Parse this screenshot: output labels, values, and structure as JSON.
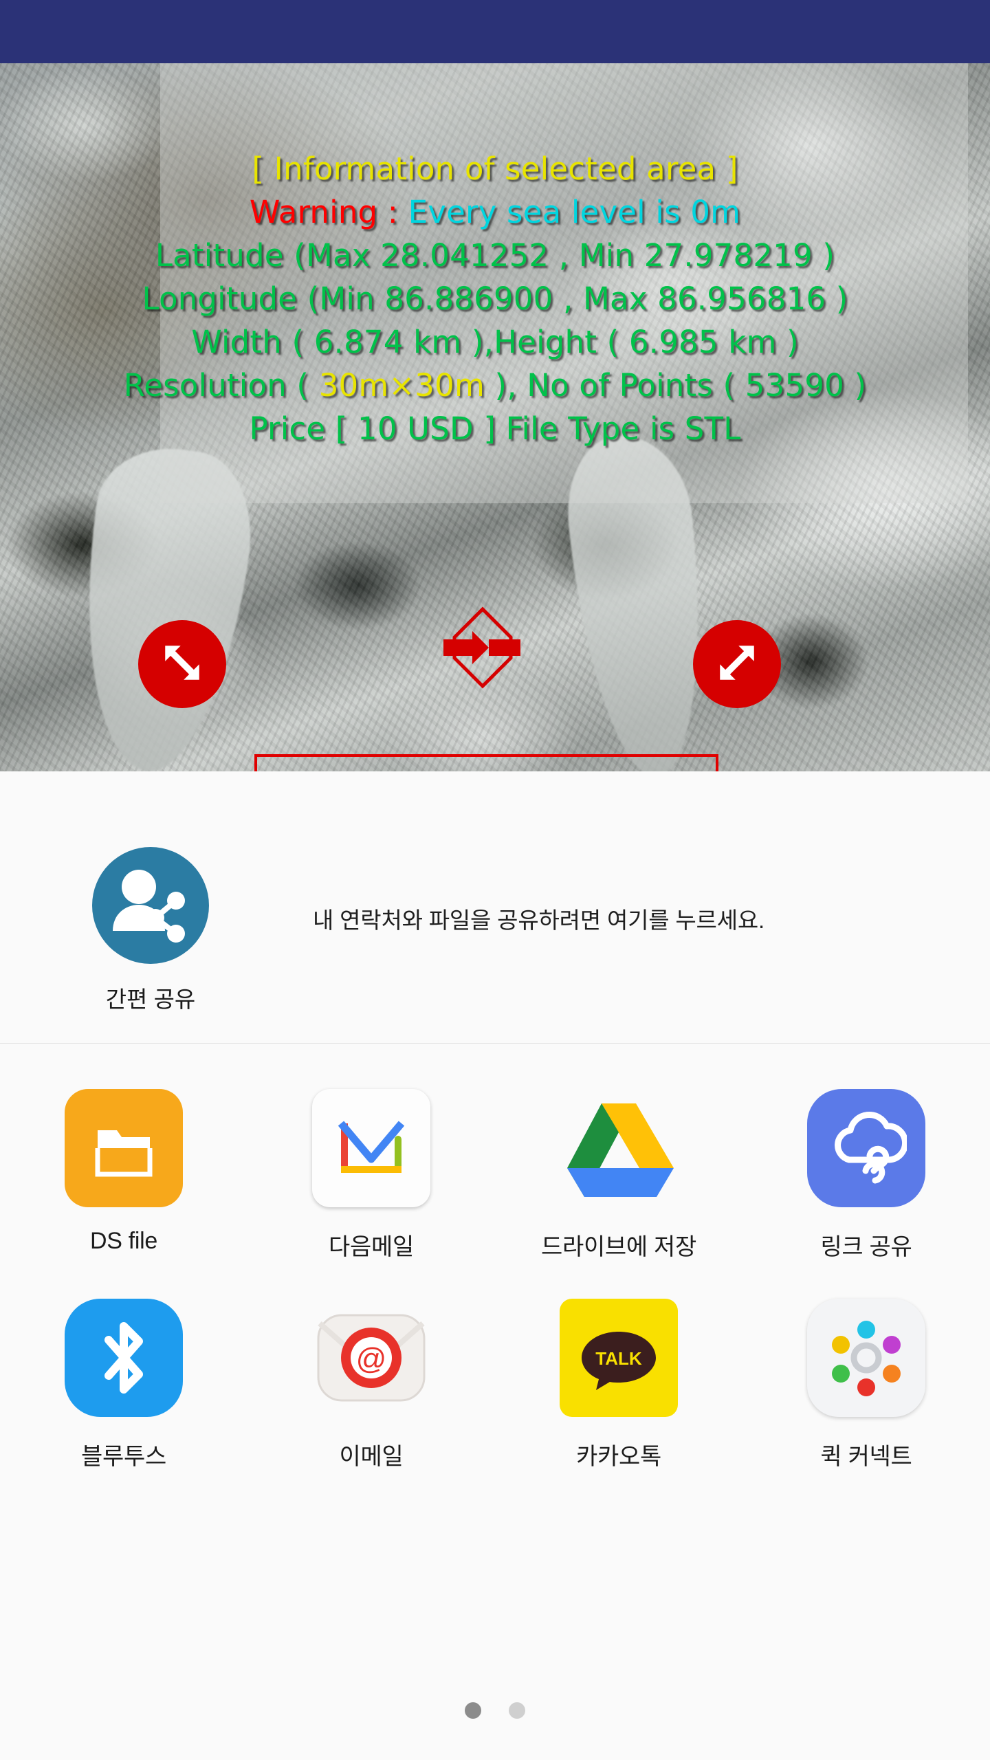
{
  "statusbar": {
    "color": "#2b3277"
  },
  "map_overlay": {
    "title": "[ Information of selected area ]",
    "warning_label": "Warning :",
    "warning_text": " Every sea level is 0m",
    "latitude": "Latitude (Max 28.041252 , Min 27.978219 )",
    "longitude": "Longitude (Min 86.886900 , Max 86.956816 )",
    "size": "Width ( 6.874 km ),Height ( 6.985 km )",
    "resolution_prefix": "Resolution ( ",
    "resolution_value": "30m×30m",
    "resolution_suffix": " ), No of Points ( 53590 )",
    "price": "Price [ 10 USD ] File Type is STL",
    "colors": {
      "title": "#e8e400",
      "warning": "#ff0000",
      "warning_text": "#00d6e0",
      "body": "#00c24a",
      "resolution_value": "#e8e400"
    }
  },
  "map_controls": {
    "resize_left_icon": "resize-diagonal-icon",
    "resize_right_icon": "resize-diagonal-icon",
    "move_icon": "move-horizontal-icon",
    "handle_color": "#d50000",
    "selection_color": "#e00000"
  },
  "direct_share": {
    "icon": "person-share-icon",
    "label": "간편 공유",
    "hint": "내 연락처와 파일을 공유하려면 여기를 누르세요.",
    "accent": "#2b7ca3"
  },
  "apps": {
    "row1": [
      {
        "label": "DS file",
        "icon": "ds-file-icon"
      },
      {
        "label": "다음메일",
        "icon": "daum-mail-icon"
      },
      {
        "label": "드라이브에 저장",
        "icon": "google-drive-icon"
      },
      {
        "label": "링크 공유",
        "icon": "link-sharing-icon"
      }
    ],
    "row2": [
      {
        "label": "블루투스",
        "icon": "bluetooth-icon"
      },
      {
        "label": "이메일",
        "icon": "email-icon"
      },
      {
        "label": "카카오톡",
        "icon": "kakaotalk-icon",
        "badge": "TALK"
      },
      {
        "label": "퀵 커넥트",
        "icon": "quick-connect-icon"
      }
    ]
  },
  "pagination": {
    "pages": 2,
    "current": 1
  }
}
